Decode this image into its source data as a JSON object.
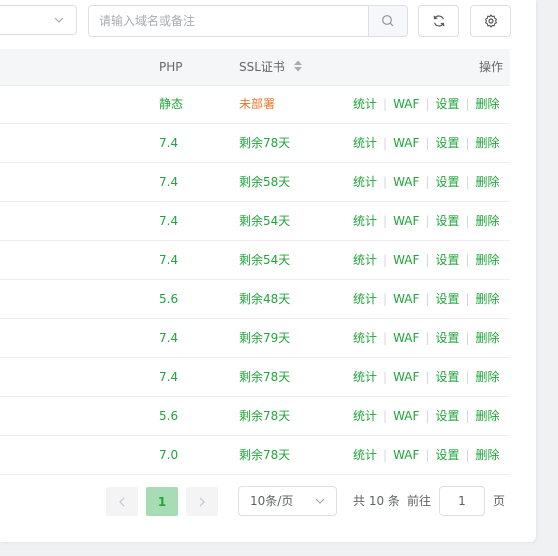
{
  "toolbar": {
    "search_placeholder": "请输入域名或备注",
    "search_icon": "search-icon",
    "refresh_icon": "refresh-icon",
    "settings_icon": "gear-icon"
  },
  "table": {
    "headers": {
      "php": "PHP",
      "ssl": "SSL证书",
      "ops": "操作"
    },
    "rows": [
      {
        "php": "静态",
        "ssl": "未部署",
        "ssl_status": "warn"
      },
      {
        "php": "7.4",
        "ssl": "剩余78天",
        "ssl_status": "ok"
      },
      {
        "php": "7.4",
        "ssl": "剩余58天",
        "ssl_status": "ok"
      },
      {
        "php": "7.4",
        "ssl": "剩余54天",
        "ssl_status": "ok"
      },
      {
        "php": "7.4",
        "ssl": "剩余54天",
        "ssl_status": "ok"
      },
      {
        "php": "5.6",
        "ssl": "剩余48天",
        "ssl_status": "ok"
      },
      {
        "php": "7.4",
        "ssl": "剩余79天",
        "ssl_status": "ok"
      },
      {
        "php": "7.4",
        "ssl": "剩余78天",
        "ssl_status": "ok"
      },
      {
        "php": "5.6",
        "ssl": "剩余78天",
        "ssl_status": "ok"
      },
      {
        "php": "7.0",
        "ssl": "剩余78天",
        "ssl_status": "ok"
      }
    ],
    "actions": [
      "统计",
      "WAF",
      "设置",
      "删除"
    ]
  },
  "pagination": {
    "current_page": "1",
    "page_size": "10条/页",
    "total": "共 10 条",
    "goto_label": "前往",
    "goto_value": "1",
    "page_suffix": "页"
  },
  "colors": {
    "accent": "#20a53a",
    "warn": "#e6772a"
  }
}
